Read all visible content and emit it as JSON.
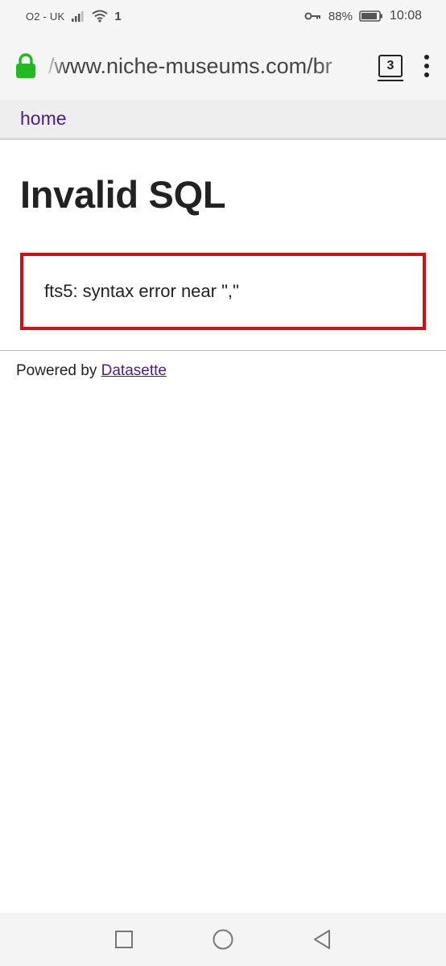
{
  "status_bar": {
    "carrier": "O2 - UK",
    "signal_icon": "signal-bars-icon",
    "wifi_icon": "wifi-icon",
    "extra_indicator": "1",
    "vpn_key_icon": "key-icon",
    "battery_percent": "88%",
    "battery_icon": "battery-icon",
    "time": "10:08"
  },
  "browser": {
    "url": "/www.niche-museums.com/br",
    "tab_count": "3",
    "lock_icon": "lock-icon",
    "menu_icon": "more-vert-icon"
  },
  "page": {
    "nav_link": "home",
    "title": "Invalid SQL",
    "error_message": "fts5: syntax error near \",\"",
    "footer_prefix": "Powered by ",
    "footer_link": "Datasette"
  },
  "nav_bar": {
    "recents_icon": "square-icon",
    "home_icon": "circle-icon",
    "back_icon": "triangle-back-icon"
  },
  "colors": {
    "link": "#4d1d85",
    "error_border": "#cc1111",
    "lock": "#1fbb1f"
  }
}
